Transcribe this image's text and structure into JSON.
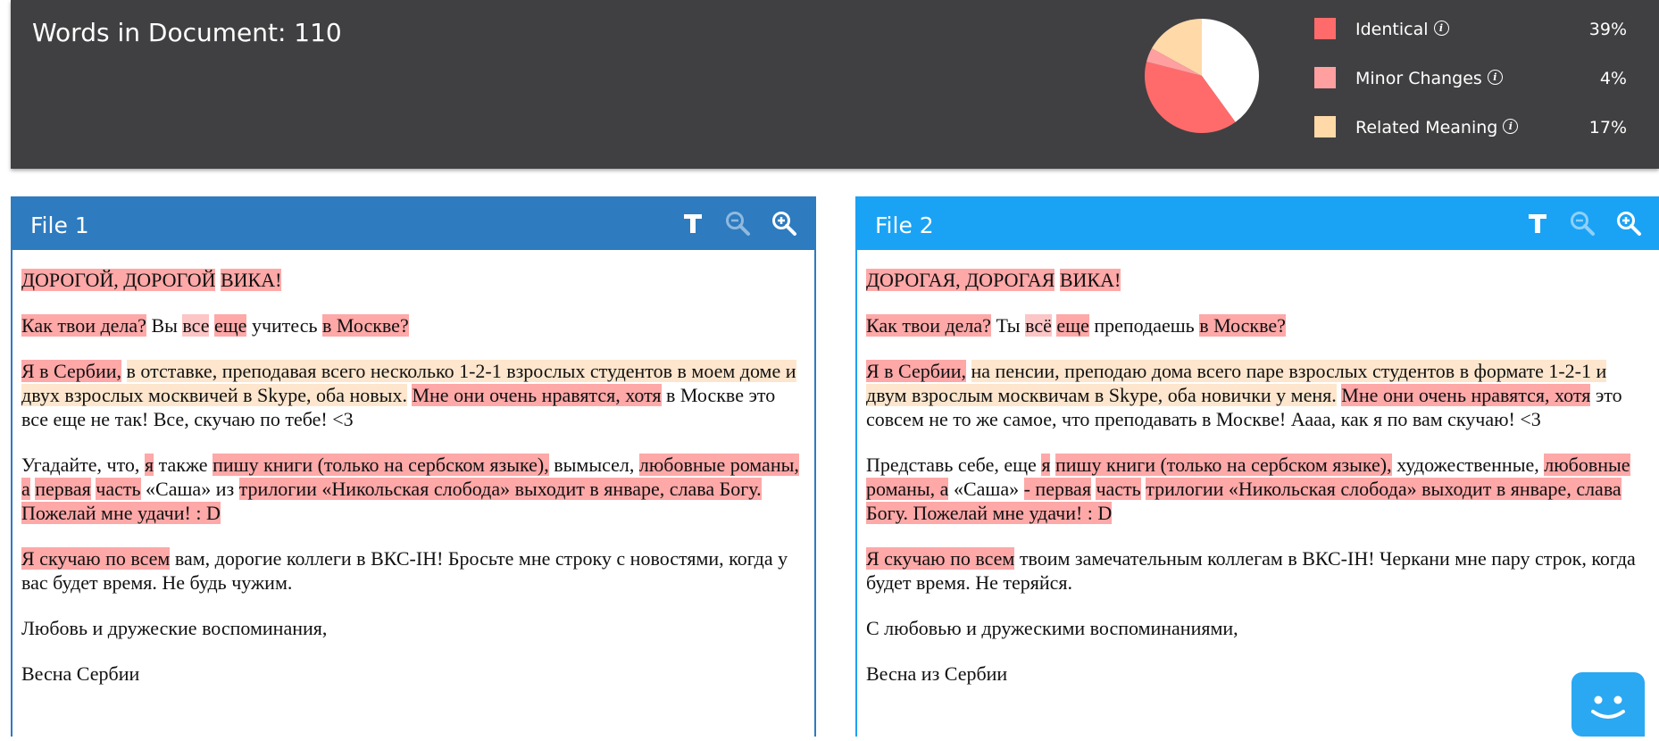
{
  "header": {
    "words_label": "Words in Document: 110"
  },
  "chart_data": {
    "type": "pie",
    "slices": [
      {
        "name": "Identical",
        "value": 39,
        "color": "#ff6b6b"
      },
      {
        "name": "Minor Changes",
        "value": 4,
        "color": "#ff9fa0"
      },
      {
        "name": "Related Meaning",
        "value": 17,
        "color": "#ffd9a8"
      },
      {
        "name": "",
        "value": 40,
        "color": "#ffffff"
      }
    ]
  },
  "legend": [
    {
      "label": "Identical",
      "pct": "39%",
      "color": "#ff6b6b"
    },
    {
      "label": "Minor Changes",
      "pct": "4%",
      "color": "#ff9fa0"
    },
    {
      "label": "Related Meaning",
      "pct": "17%",
      "color": "#ffd9a8"
    }
  ],
  "colors": {
    "identical": "#fea8a8",
    "minor": "#fcc5c6",
    "related": "#fde6cd",
    "panel1_header": "#2e7bbf",
    "panel2_header": "#1aa3f5"
  },
  "icons": {
    "toolbar": [
      "font-size-icon",
      "zoom-out-icon",
      "zoom-in-icon"
    ],
    "info": "info-icon",
    "chat": "chat-bot-icon"
  },
  "file1": {
    "title": "File 1",
    "paragraphs": [
      [
        [
          "hl-id",
          "ДОРОГОЙ, ДОРОГОЙ"
        ],
        [
          "",
          " "
        ],
        [
          "hl-id",
          "ВИКА!"
        ]
      ],
      [
        [
          "hl-id",
          "Как твои дела?"
        ],
        [
          "",
          " Вы "
        ],
        [
          "hl-minor",
          "все"
        ],
        [
          "",
          " "
        ],
        [
          "hl-id",
          "еще"
        ],
        [
          "",
          " учитесь "
        ],
        [
          "hl-id",
          "в Москве?"
        ]
      ],
      [
        [
          "hl-id",
          "Я в Сербии,"
        ],
        [
          "",
          " "
        ],
        [
          "hl-rel",
          "в отставке, преподавая всего несколько 1-2-1 взрослых студентов в моем доме и двух взрослых москвичей в Skype, оба новых."
        ],
        [
          "",
          " "
        ],
        [
          "hl-id",
          "Мне они очень нравятся, хотя"
        ],
        [
          "",
          " в Москве это все еще не так! Все, скучаю по тебе! <3"
        ]
      ],
      [
        [
          "",
          "Угадайте, что, "
        ],
        [
          "hl-id",
          "я"
        ],
        [
          "",
          " также "
        ],
        [
          "hl-id",
          "пишу книги (только на сербском языке),"
        ],
        [
          "",
          " вымысел, "
        ],
        [
          "hl-id",
          "любовные романы, а"
        ],
        [
          "",
          " "
        ],
        [
          "hl-id",
          "первая"
        ],
        [
          "",
          " "
        ],
        [
          "hl-id",
          "часть"
        ],
        [
          "",
          " «Саша» из "
        ],
        [
          "hl-id",
          "трилогии «Никольская слобода» выходит в январе, слава Богу. Пожелай мне удачи! : D"
        ]
      ],
      [
        [
          "hl-id",
          "Я скучаю по всем"
        ],
        [
          "",
          " вам, дорогие коллеги в ВКС-IH! Бросьте мне строку с новостями, когда у вас будет время. Не будь чужим."
        ]
      ],
      [
        [
          "",
          "Любовь и дружеские воспоминания,"
        ]
      ],
      [
        [
          "",
          "Весна Сербии"
        ]
      ]
    ]
  },
  "file2": {
    "title": "File 2",
    "paragraphs": [
      [
        [
          "hl-id",
          "ДОРОГАЯ, ДОРОГАЯ"
        ],
        [
          "",
          " "
        ],
        [
          "hl-id",
          "ВИКА!"
        ]
      ],
      [
        [
          "hl-id",
          "Как твои дела?"
        ],
        [
          "",
          " Ты "
        ],
        [
          "hl-minor",
          "всё"
        ],
        [
          "",
          " "
        ],
        [
          "hl-id",
          "еще"
        ],
        [
          "",
          " преподаешь "
        ],
        [
          "hl-id",
          "в Москве?"
        ]
      ],
      [
        [
          "hl-id",
          "Я в Сербии,"
        ],
        [
          "",
          " "
        ],
        [
          "hl-rel",
          "на пенсии, преподаю дома всего паре взрослых студентов в формате 1-2-1 и двум взрослым москвичам в Skype, оба новички у меня."
        ],
        [
          "",
          " "
        ],
        [
          "hl-id",
          "Мне они очень нравятся, хотя"
        ],
        [
          "",
          " это совсем не то же самое, что преподавать в Москве! Аааа, как я по вам скучаю! <3"
        ]
      ],
      [
        [
          "",
          "Представь себе, еще "
        ],
        [
          "hl-id",
          "я"
        ],
        [
          "",
          " "
        ],
        [
          "hl-id",
          "пишу книги (только на сербском языке),"
        ],
        [
          "",
          " художественные, "
        ],
        [
          "hl-id",
          "любовные романы, а"
        ],
        [
          "",
          " «Саша» "
        ],
        [
          "hl-id",
          "- первая"
        ],
        [
          "",
          " "
        ],
        [
          "hl-id",
          "часть"
        ],
        [
          "",
          " "
        ],
        [
          "hl-id",
          "трилогии «Никольская слобода» выходит в январе, слава Богу. Пожелай мне удачи! : D"
        ]
      ],
      [
        [
          "hl-id",
          "Я скучаю по всем"
        ],
        [
          "",
          " твоим замечательным коллегам в ВКС-IH! Черкани мне пару строк, когда будет время. Не теряйся."
        ]
      ],
      [
        [
          "",
          "С любовью и дружескими воспоминаниями,"
        ]
      ],
      [
        [
          "",
          "Весна из Сербии"
        ]
      ]
    ]
  }
}
